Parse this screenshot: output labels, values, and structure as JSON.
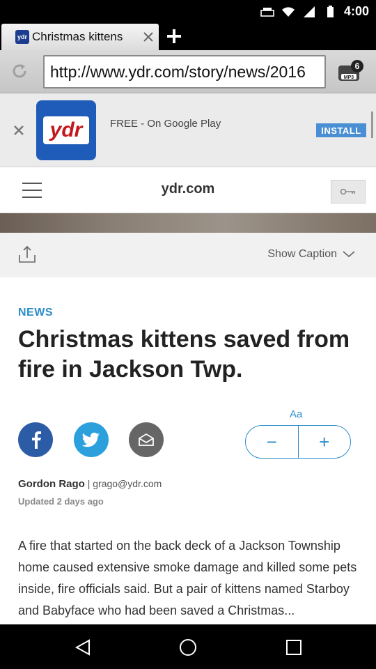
{
  "status_bar": {
    "time": "4:00"
  },
  "tab": {
    "favicon_text": "ydr",
    "title": "Christmas kittens"
  },
  "url_bar": {
    "url": "http://www.ydr.com/story/news/2016",
    "badge_count": "6",
    "badge_label": "MP3"
  },
  "app_banner": {
    "logo_text": "ydr",
    "text": "FREE - On Google Play",
    "install_label": "INSTALL"
  },
  "site_header": {
    "logo": "ydr.com"
  },
  "caption_bar": {
    "show_caption_label": "Show Caption"
  },
  "article": {
    "section": "NEWS",
    "headline": "Christmas kittens saved from fire in Jackson Twp.",
    "font_size_label": "Aa",
    "decrease_label": "−",
    "increase_label": "+",
    "author": "Gordon Rago",
    "author_email": "| grago@ydr.com",
    "updated": "Updated 2 days ago",
    "body": "A fire that started on the back deck of a Jackson Township home caused extensive smoke damage and killed some pets inside, fire officials said. But a pair of kittens named Starboy and Babyface who had been saved a Christmas..."
  },
  "colors": {
    "accent": "#2b8ccb",
    "facebook": "#2d5ca6",
    "twitter": "#2ba0dd",
    "ydr_red": "#c4161c"
  }
}
